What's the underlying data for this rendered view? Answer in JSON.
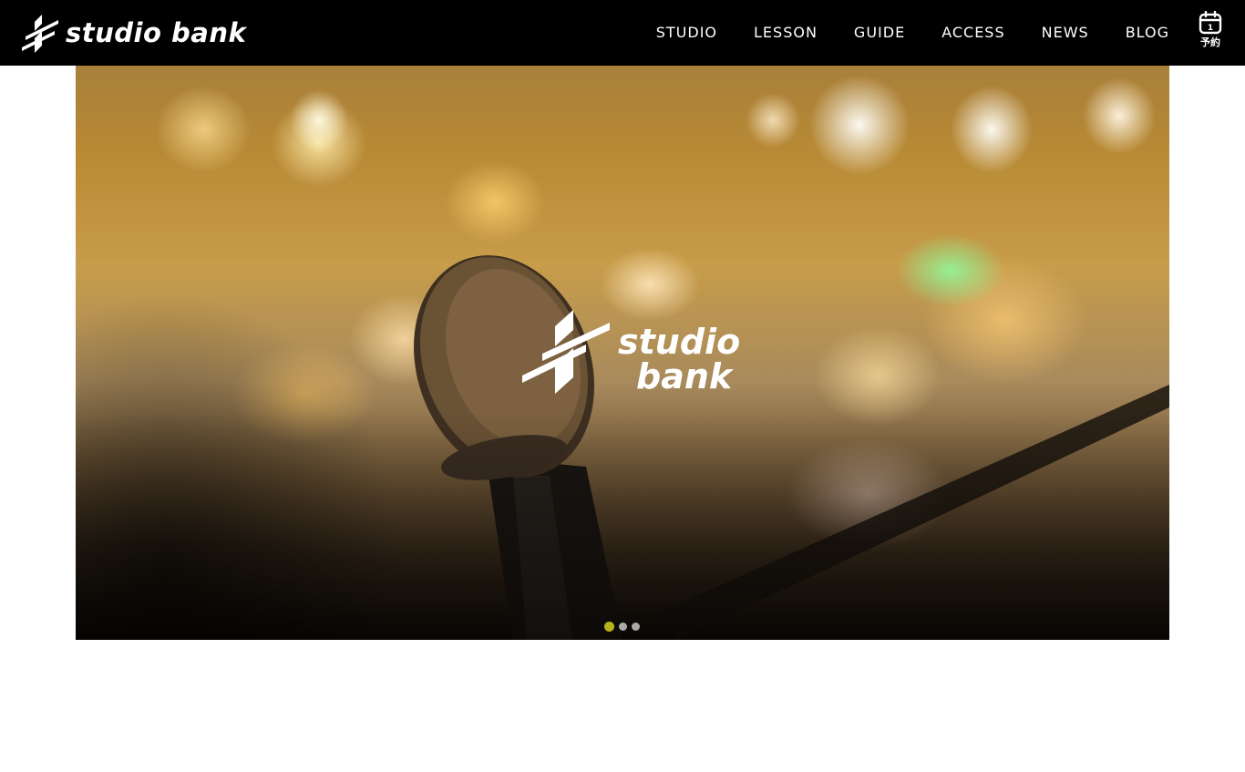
{
  "header": {
    "logo_text": "studio bank",
    "nav": [
      {
        "label": "STUDIO"
      },
      {
        "label": "LESSON"
      },
      {
        "label": "GUIDE"
      },
      {
        "label": "ACCESS"
      },
      {
        "label": "NEWS"
      },
      {
        "label": "BLOG"
      }
    ],
    "reserve_label": "予約",
    "reserve_icon": "calendar-icon",
    "reserve_icon_day": "1"
  },
  "hero": {
    "logo_line1": "studio",
    "logo_line2": "bank",
    "slider": {
      "total_slides": 3,
      "active_index": 0
    }
  },
  "colors": {
    "header_bg": "#000000",
    "text_on_dark": "#ffffff",
    "active_dot": "#b5b51a",
    "inactive_dot": "#a9a9a9",
    "page_bg": "#ffffff"
  }
}
